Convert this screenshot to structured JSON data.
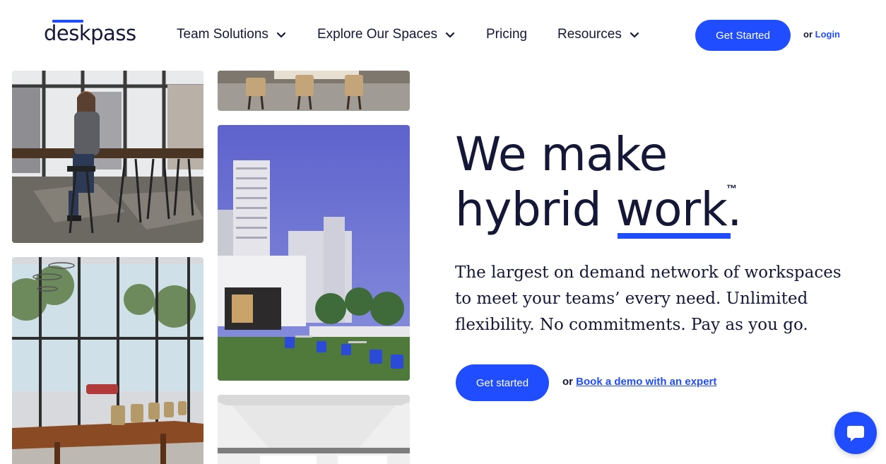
{
  "header": {
    "logo_text": "deskpass",
    "nav": [
      {
        "label": "Team Solutions",
        "has_dropdown": true
      },
      {
        "label": "Explore Our Spaces",
        "has_dropdown": true
      },
      {
        "label": "Pricing",
        "has_dropdown": false
      },
      {
        "label": "Resources",
        "has_dropdown": true
      }
    ],
    "cta_label": "Get Started",
    "or_label": "or",
    "login_label": "Login"
  },
  "hero": {
    "headline_line1": "We make",
    "headline_line2_pre": "hybrid ",
    "headline_highlight": "work.",
    "trademark": "™",
    "subtext": "The largest on demand network of workspaces to meet your teams’ every need. Unlimited flexibility. No commitments. Pay as you go.",
    "cta_label": "Get started",
    "or_label": "or",
    "demo_link": "Book a demo with an expert"
  },
  "colors": {
    "brand_blue": "#1f4dff",
    "text_dark": "#141735"
  },
  "icons": {
    "dropdown": "chevron-down-icon",
    "chat": "chat-bubble-icon"
  }
}
